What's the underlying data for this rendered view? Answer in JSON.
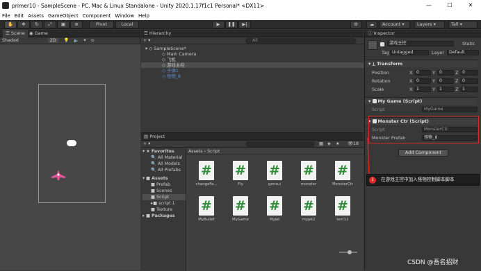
{
  "window": {
    "title": "primer10 - SampleScene - PC, Mac & Linux Standalone - Unity 2020.1.17f1c1 Personal* <DX11>",
    "min": "—",
    "max": "☐",
    "close": "✕"
  },
  "menu": [
    "File",
    "Edit",
    "Assets",
    "GameObject",
    "Component",
    "Window",
    "Help"
  ],
  "toolbar": {
    "pivot": "Pivot",
    "local": "Local",
    "account": "Account",
    "layers": "Layers",
    "layout": "Tall"
  },
  "scene": {
    "tab_scene": "Scene",
    "tab_game": "Game",
    "shading": "Shaded",
    "mode_2d": "2D"
  },
  "hierarchy": {
    "tab": "Hierarchy",
    "search_placeholder": "All",
    "scene_name": "SampleScene*",
    "items": [
      "Main Camera",
      "飞机",
      "游戏主控",
      "子弹1",
      "怪物_8"
    ]
  },
  "project": {
    "tab": "Project",
    "favorites": "Favorites",
    "fav_items": [
      "All Material",
      "All Models",
      "All Prefabs"
    ],
    "assets": "Assets",
    "asset_items": [
      "Prefab",
      "Scenes",
      "Script",
      "script 1",
      "Texture"
    ],
    "packages": "Packages",
    "breadcrumb_root": "Assets",
    "breadcrumb_sep": "›",
    "breadcrumb_leaf": "Script",
    "count": "18",
    "scripts": [
      "changeFa...",
      "Fly",
      "gensui",
      "monster",
      "MonsterCtr",
      "MyBullet",
      "MyGame",
      "MyJet",
      "myjet2",
      "test12"
    ]
  },
  "inspector": {
    "tab": "Inspector",
    "object_name": "游戏主控",
    "static": "Static",
    "tag_label": "Tag",
    "tag_value": "Untagged",
    "layer_label": "Layer",
    "layer_value": "Default",
    "transform": {
      "title": "Transform",
      "rows": [
        {
          "label": "Position",
          "x": "0",
          "y": "0",
          "z": "0"
        },
        {
          "label": "Rotation",
          "x": "0",
          "y": "0",
          "z": "0"
        },
        {
          "label": "Scale",
          "x": "1",
          "y": "1",
          "z": "1"
        }
      ]
    },
    "mygame": {
      "title": "My Game (Script)",
      "script_label": "Script",
      "script_value": "MyGame"
    },
    "monster": {
      "title": "Monster Ctr (Script)",
      "script_label": "Script",
      "script_value": "MonsterCtr",
      "prefab_label": "Monster Prefab",
      "prefab_value": "怪物_8"
    },
    "add_component": "Add Component"
  },
  "annotation": {
    "number": "1",
    "text": "在游戏主控中加入怪物控制脚本脚本"
  },
  "watermark": "CSDN @吾名招财",
  "colors": {
    "annotation_red": "#e02828",
    "selection_blue": "#3d5a80",
    "script_green": "#2f8a38"
  }
}
